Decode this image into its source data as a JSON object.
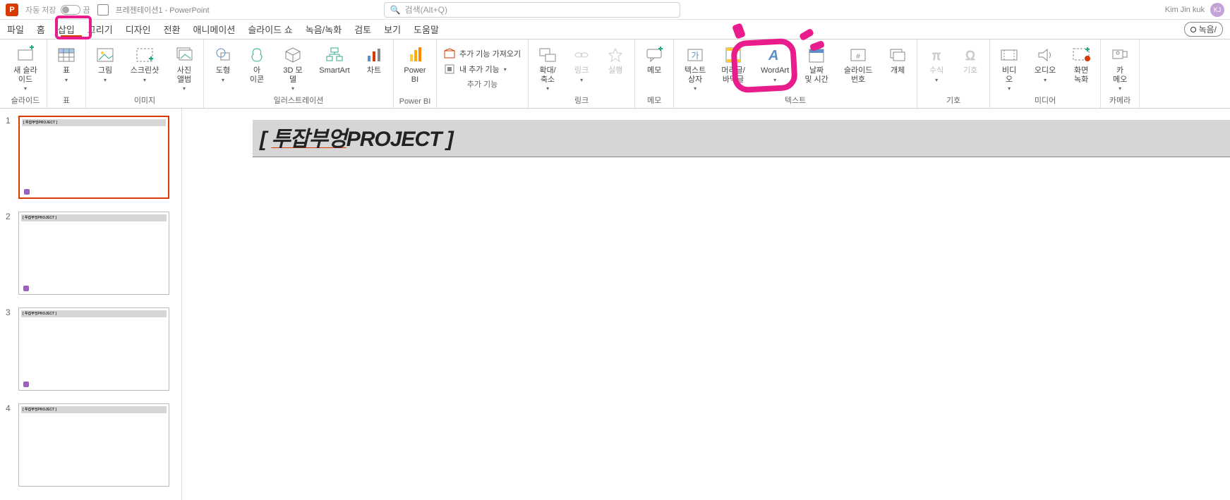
{
  "titlebar": {
    "autosave_label": "자동 저장",
    "autosave_state": "끔",
    "doc_title": "프레젠테이션1 - PowerPoint",
    "search_placeholder": "검색(Alt+Q)",
    "user_name": "Kim Jin kuk",
    "user_initials": "KJ"
  },
  "tabs": {
    "file": "파일",
    "home": "홈",
    "insert": "삽입",
    "draw": "그리기",
    "design": "디자인",
    "transitions": "전환",
    "animations": "애니메이션",
    "slideshow": "슬라이드 쇼",
    "record": "녹음/녹화",
    "review": "검토",
    "view": "보기",
    "help": "도움말",
    "record_btn": "녹음/"
  },
  "ribbon": {
    "slides": {
      "group": "슬라이드",
      "new_slide": "새 슬라\n이드"
    },
    "tables": {
      "group": "표",
      "table": "표"
    },
    "images": {
      "group": "이미지",
      "picture": "그림",
      "screenshot": "스크린샷",
      "album": "사진\n앨범"
    },
    "illustrations": {
      "group": "일러스트레이션",
      "shapes": "도형",
      "icons": "아\n이콘",
      "models3d": "3D 모\n델",
      "smartart": "SmartArt",
      "chart": "차트"
    },
    "powerbi": {
      "group": "Power BI",
      "pbi": "Power\nBI"
    },
    "addins": {
      "group": "추가 기능",
      "getaddins": "추가 기능 가져오기",
      "myaddins": "내 추가 기능"
    },
    "links": {
      "group": "링크",
      "zoom": "확대/\n축소",
      "link": "링크",
      "action": "실행"
    },
    "comments": {
      "group": "메모",
      "comment": "메모"
    },
    "text": {
      "group": "텍스트",
      "textbox": "텍스트\n상자",
      "headerfooter": "머리글/\n바닥글",
      "wordart": "WordArt",
      "datetime": "날짜\n및 시간",
      "slidenum": "슬라이드\n번호",
      "object": "개체"
    },
    "symbols": {
      "group": "기호",
      "equation": "수식",
      "symbol": "기호"
    },
    "media": {
      "group": "미디어",
      "video": "비디\n오",
      "audio": "오디오",
      "screen_rec": "화면\n녹화"
    },
    "camera": {
      "group": "카메라",
      "cameo": "카\n메오"
    }
  },
  "slide_content": {
    "thumb_label": "[ 투잡부엉PROJECT ]",
    "title_open": "[ ",
    "title_word1": "투잡부엉",
    "title_word2": "PROJECT",
    "title_close": " ]"
  },
  "thumbs": [
    "1",
    "2",
    "3",
    "4"
  ]
}
